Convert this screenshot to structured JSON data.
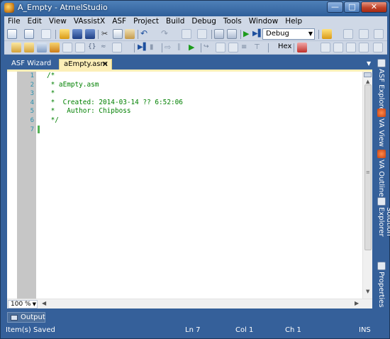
{
  "window": {
    "title": "A_Empty - AtmelStudio",
    "min": "—",
    "max": "□",
    "close": "✕"
  },
  "menu": [
    "File",
    "Edit",
    "View",
    "VAssistX",
    "ASF",
    "Project",
    "Build",
    "Debug",
    "Tools",
    "Window",
    "Help"
  ],
  "toolbar": {
    "configuration": "Debug",
    "hex_label": "Hex"
  },
  "tabs": {
    "inactive": "ASF Wizard",
    "active": "aEmpty.asm",
    "close": "✕"
  },
  "editor": {
    "line_numbers": [
      "1",
      "2",
      "3",
      "4",
      "5",
      "6",
      "7"
    ],
    "lines": [
      "/*",
      " * aEmpty.asm",
      " *",
      " *  Created: 2014-03-14 ?? 6:52:06",
      " *   Author: Chipboss",
      " */",
      ""
    ],
    "zoom": "100 %"
  },
  "side_tabs": [
    "ASF Explorer",
    "VA View",
    "VA Outline",
    "Solution Explorer",
    "Properties"
  ],
  "output_tab": "Output",
  "status": {
    "message": "Item(s) Saved",
    "ln": "Ln 7",
    "col": "Col 1",
    "ch": "Ch 1",
    "mode": "INS"
  }
}
